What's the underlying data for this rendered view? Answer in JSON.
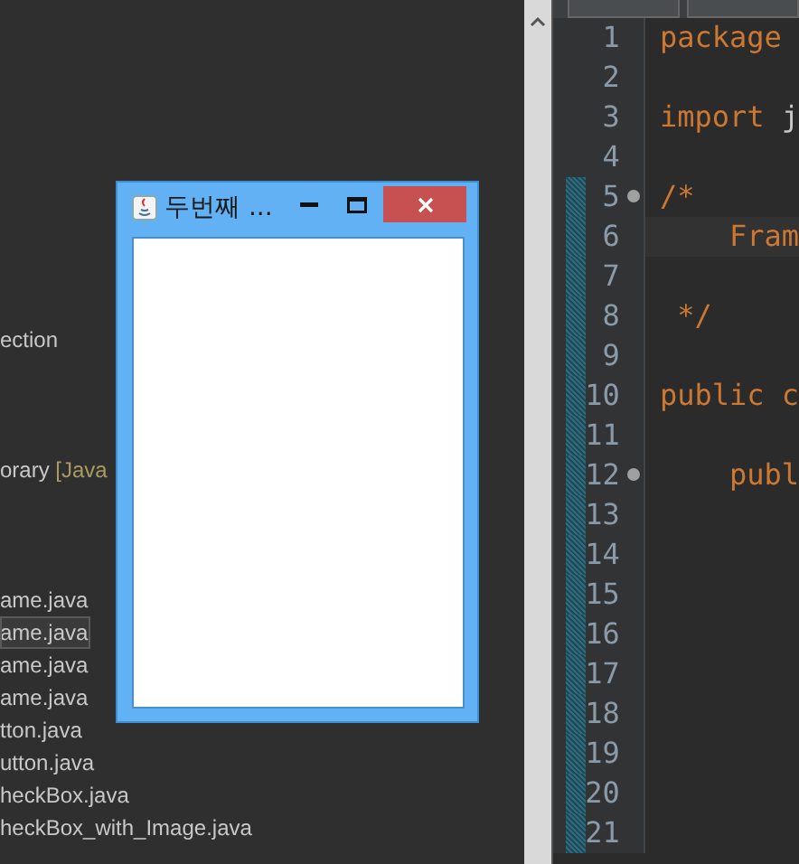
{
  "explorer": {
    "items": [
      {
        "text": "ection",
        "selected": false
      },
      {
        "text": "orary",
        "tag": "[Java",
        "selected": false
      },
      {
        "text": "ame.java",
        "selected": false
      },
      {
        "text": "ame.java",
        "selected": true
      },
      {
        "text": "ame.java",
        "selected": false
      },
      {
        "text": "ame.java",
        "selected": false
      },
      {
        "text": "tton.java",
        "selected": false
      },
      {
        "text": "utton.java",
        "selected": false
      },
      {
        "text": "heckBox.java",
        "selected": false
      },
      {
        "text": "heckBox_with_Image.java",
        "selected": false
      }
    ]
  },
  "editor": {
    "lines": [
      {
        "number": "1",
        "tokens": [
          {
            "text": "package",
            "kind": "keyword"
          }
        ]
      },
      {
        "number": "2"
      },
      {
        "number": "3",
        "tokens": [
          {
            "text": "import",
            "kind": "keyword"
          },
          {
            "text": " j",
            "kind": "plain"
          }
        ]
      },
      {
        "number": "4"
      },
      {
        "number": "5",
        "fold": true,
        "tokens": [
          {
            "text": "/*",
            "kind": "comment"
          }
        ]
      },
      {
        "number": "6",
        "highlighted": true,
        "tokens": [
          {
            "text": "    Fram",
            "kind": "comment"
          }
        ]
      },
      {
        "number": "7"
      },
      {
        "number": "8",
        "tokens": [
          {
            "text": " */",
            "kind": "comment"
          }
        ]
      },
      {
        "number": "9"
      },
      {
        "number": "10",
        "tokens": [
          {
            "text": "public c",
            "kind": "keyword"
          }
        ]
      },
      {
        "number": "11"
      },
      {
        "number": "12",
        "fold": true,
        "tokens": [
          {
            "text": "    publ",
            "kind": "keyword"
          }
        ]
      },
      {
        "number": "13"
      },
      {
        "number": "14"
      },
      {
        "number": "15"
      },
      {
        "number": "16"
      },
      {
        "number": "17"
      },
      {
        "number": "18"
      },
      {
        "number": "19"
      },
      {
        "number": "20"
      },
      {
        "number": "21"
      }
    ]
  },
  "frame": {
    "title": "두번째 ..."
  }
}
